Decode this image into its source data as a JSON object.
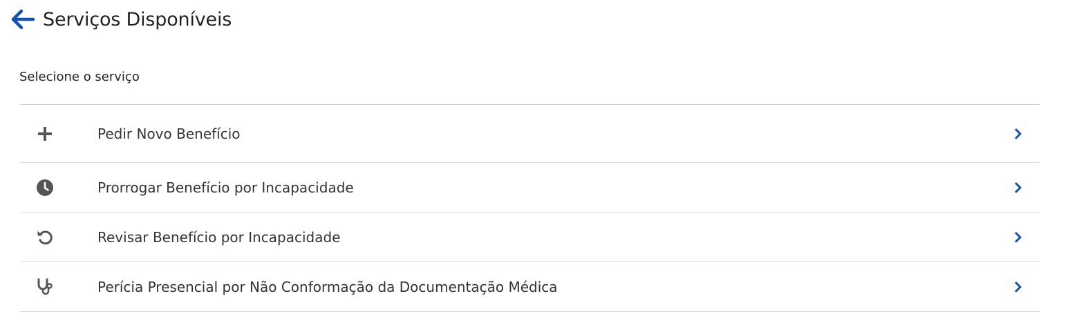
{
  "header": {
    "back_icon": "arrow-left-icon",
    "title": "Serviços Disponíveis"
  },
  "section": {
    "label": "Selecione o serviço"
  },
  "services": [
    {
      "label": "Pedir Novo Benefício",
      "icon": "plus-icon"
    },
    {
      "label": "Prorrogar Benefício por Incapacidade",
      "icon": "clock-icon"
    },
    {
      "label": "Revisar Benefício por Incapacidade",
      "icon": "undo-icon"
    },
    {
      "label": "Perícia Presencial por Não Conformação da Documentação Médica",
      "icon": "stethoscope-icon"
    }
  ],
  "colors": {
    "accent": "#1351b4",
    "icon": "#555555",
    "divider": "#dcdcdc"
  }
}
